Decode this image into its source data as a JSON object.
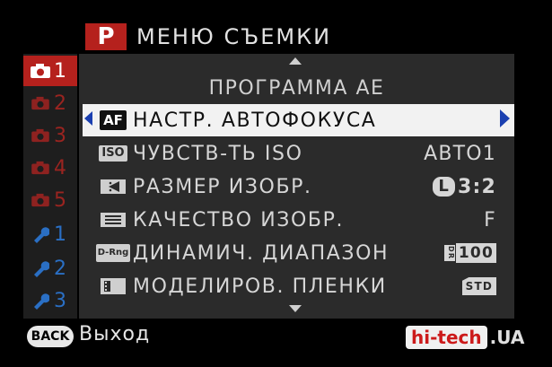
{
  "header": {
    "mode": "P",
    "title": "МЕНЮ СЪЕМКИ"
  },
  "tabs": [
    {
      "icon": "camera-icon",
      "number": "1",
      "active": true
    },
    {
      "icon": "camera-icon",
      "number": "2",
      "active": false
    },
    {
      "icon": "camera-icon",
      "number": "3",
      "active": false
    },
    {
      "icon": "camera-icon",
      "number": "4",
      "active": false
    },
    {
      "icon": "camera-icon",
      "number": "5",
      "active": false
    },
    {
      "icon": "wrench-icon",
      "number": "1",
      "active": false
    },
    {
      "icon": "wrench-icon",
      "number": "2",
      "active": false
    },
    {
      "icon": "wrench-icon",
      "number": "3",
      "active": false
    }
  ],
  "menu": {
    "section_title": "ПРОГРАММА АЕ",
    "rows": [
      {
        "icon_label": "AF",
        "label": "НАСТР. АВТОФОКУСА",
        "value": "",
        "selected": true
      },
      {
        "icon_label": "ISO",
        "label": "ЧУВСТВ-ТЬ ISO",
        "value": "АВТО1",
        "selected": false
      },
      {
        "icon_label": "",
        "label": "РАЗМЕР ИЗОБР.",
        "value": "3:2",
        "value_badge": "L",
        "selected": false
      },
      {
        "icon_label": "",
        "label": "КАЧЕСТВО ИЗОБР.",
        "value": "F",
        "selected": false
      },
      {
        "icon_label": "D-Rng",
        "label": "ДИНАМИЧ. ДИАПАЗОН",
        "value": "100",
        "value_badge": "DR",
        "selected": false
      },
      {
        "icon_label": "",
        "label": "МОДЕЛИРОВ. ПЛЕНКИ",
        "value": "STD",
        "selected": false
      }
    ]
  },
  "footer": {
    "back_button": "BACK",
    "back_label": "Выход"
  },
  "watermark": {
    "main": "hi-tech",
    "tld": ".UA"
  },
  "colors": {
    "accent_red": "#b5211d",
    "arrow_blue": "#1a3fb0",
    "selected_row": "#f2f2f2",
    "panel": "#2b2b2b"
  }
}
